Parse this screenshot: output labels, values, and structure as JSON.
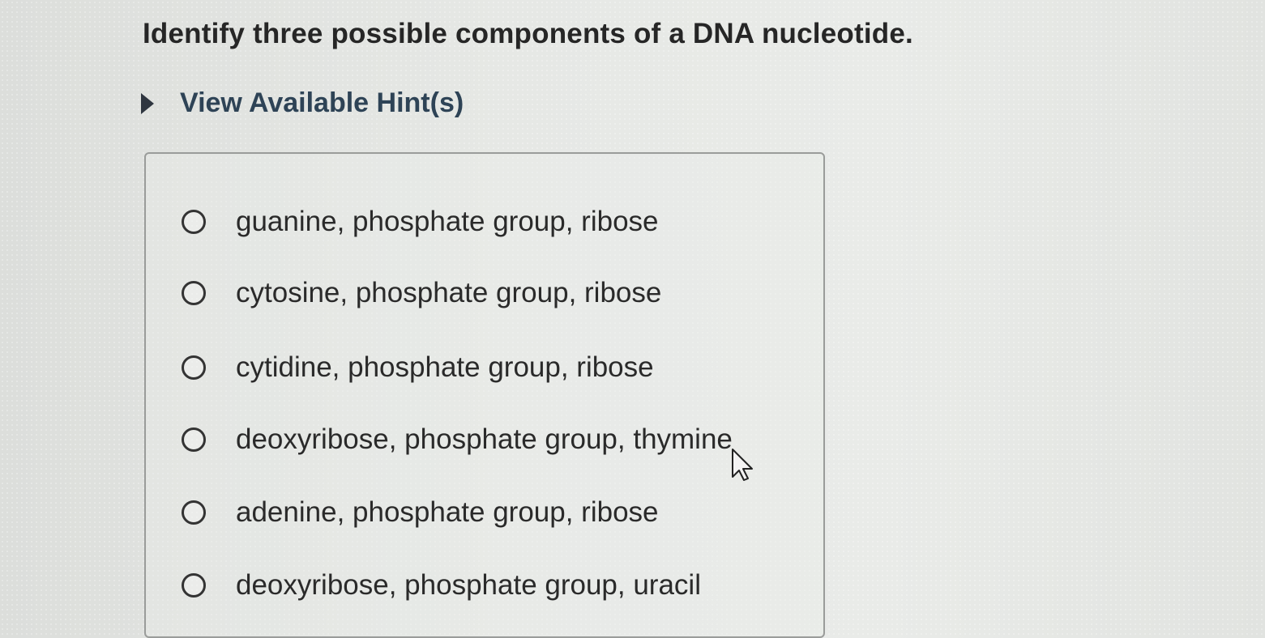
{
  "question": {
    "text": "Identify three possible components of a DNA nucleotide."
  },
  "hints": {
    "label": "View Available Hint(s)",
    "icon": "caret-right-icon"
  },
  "options": [
    {
      "label": "guanine, phosphate group, ribose",
      "selected": false
    },
    {
      "label": "cytosine, phosphate group, ribose",
      "selected": false
    },
    {
      "label": "cytidine, phosphate group, ribose",
      "selected": false
    },
    {
      "label": "deoxyribose, phosphate group, thymine",
      "selected": false
    },
    {
      "label": "adenine, phosphate group, ribose",
      "selected": false
    },
    {
      "label": "deoxyribose, phosphate group, uracil",
      "selected": false
    }
  ],
  "colors": {
    "text": "#2a2a2a",
    "hint_text": "#2e4356",
    "box_border": "#9a9c9a"
  }
}
